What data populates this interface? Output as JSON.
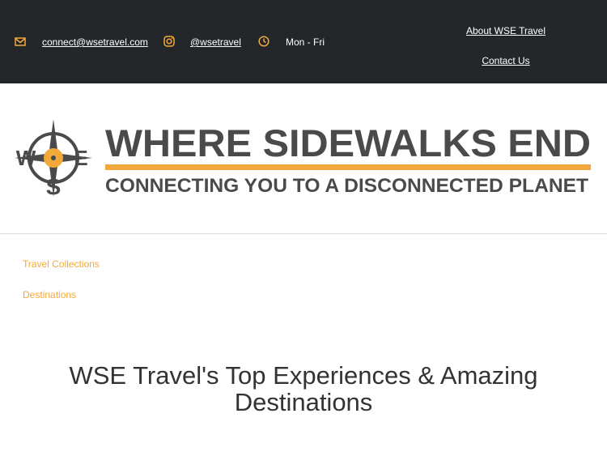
{
  "topbar": {
    "email": "connect@wsetravel.com",
    "instagram": "@wsetravel",
    "hours": "Mon - Fri",
    "about_link": "About WSE Travel",
    "contact_link": "Contact Us",
    "icon_color": "#f2a93b",
    "background": "#24272a"
  },
  "logo": {
    "emblem_letters": [
      "W",
      "S",
      "E"
    ],
    "title": "WHERE SIDEWALKS END",
    "tagline": "CONNECTING YOU TO A DISCONNECTED PLANET",
    "accent_color": "#f2a93b",
    "text_color": "#4a4a4a"
  },
  "nav": {
    "items": [
      {
        "label": "Travel Collections"
      },
      {
        "label": "Destinations"
      }
    ],
    "link_color": "#f2a93b"
  },
  "main": {
    "heading_line1": "WSE Travel's Top Experiences & Amazing",
    "heading_line2": "Destinations"
  }
}
